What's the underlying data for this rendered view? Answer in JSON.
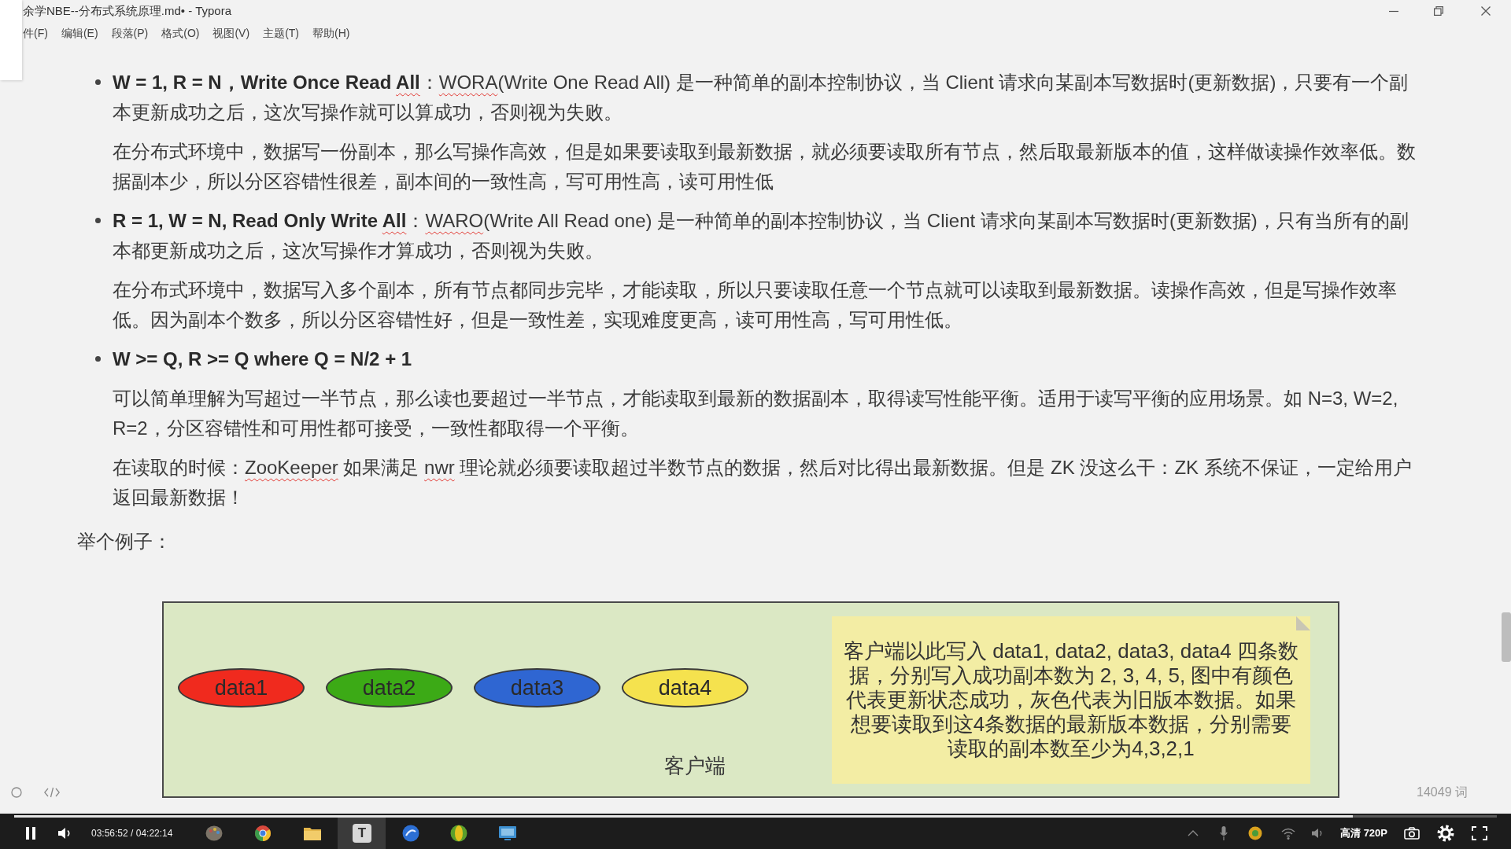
{
  "window": {
    "title": "余学NBE--分布式系统原理.md• - Typora"
  },
  "menu": [
    "件(F)",
    "编辑(E)",
    "段落(P)",
    "格式(O)",
    "视图(V)",
    "主题(T)",
    "帮助(H)"
  ],
  "document": {
    "blocks": [
      {
        "kind": "bullet",
        "runs": [
          {
            "text": "W = 1, R = N，Write Once Read ",
            "bold": true,
            "misspelled": false
          },
          {
            "text": "All",
            "bold": true,
            "misspelled": true
          },
          {
            "text": "：",
            "bold": false,
            "misspelled": false
          },
          {
            "text": "WORA",
            "bold": false,
            "misspelled": true
          },
          {
            "text": "(Write One Read All) 是一种简单的副本控制协议，当 Client 请求向某副本写数据时(更新数据)，只要有一个副本更新成功之后，这次写操作就可以算成功，否则视为失败。",
            "bold": false,
            "misspelled": false
          }
        ]
      },
      {
        "kind": "indented",
        "runs": [
          {
            "text": "在分布式环境中，数据写一份副本，那么写操作高效，但是如果要读取到最新数据，就必须要读取所有节点，然后取最新版本的值，这样做读操作效率低。数据副本少，所以分区容错性很差，副本间的一致性高，写可用性高，读可用性低",
            "bold": false,
            "misspelled": false
          }
        ]
      },
      {
        "kind": "bullet",
        "runs": [
          {
            "text": "R = 1, W = N, Read Only Write ",
            "bold": true,
            "misspelled": false
          },
          {
            "text": "All",
            "bold": true,
            "misspelled": true
          },
          {
            "text": "：",
            "bold": false,
            "misspelled": false
          },
          {
            "text": "WARO",
            "bold": false,
            "misspelled": true
          },
          {
            "text": "(Write All Read one) 是一种简单的副本控制协议，当 Client 请求向某副本写数据时(更新数据)，只有当所有的副本都更新成功之后，这次写操作才算成功，否则视为失败。",
            "bold": false,
            "misspelled": false
          }
        ]
      },
      {
        "kind": "indented",
        "runs": [
          {
            "text": "在分布式环境中，数据写入多个副本，所有节点都同步完毕，才能读取，所以只要读取任意一个节点就可以读取到最新数据。读操作高效，但是写操作效率低。因为副本个数多，所以分区容错性好，但是一致性差，实现难度更高，读可用性高，写可用性低。",
            "bold": false,
            "misspelled": false
          }
        ]
      },
      {
        "kind": "bullet",
        "runs": [
          {
            "text": "W >= Q, R >= Q where Q = N/2 + 1",
            "bold": true,
            "misspelled": false
          }
        ]
      },
      {
        "kind": "indented",
        "runs": [
          {
            "text": "可以简单理解为写超过一半节点，那么读也要超过一半节点，才能读取到最新的数据副本，取得读写性能平衡。适用于读写平衡的应用场景。如 N=3, W=2, R=2，分区容错性和可用性都可接受，一致性都取得一个平衡。",
            "bold": false,
            "misspelled": false
          }
        ]
      },
      {
        "kind": "indented",
        "runs": [
          {
            "text": "在读取的时候：",
            "bold": false,
            "misspelled": false
          },
          {
            "text": "ZooKeeper",
            "bold": false,
            "misspelled": true
          },
          {
            "text": " 如果满足 ",
            "bold": false,
            "misspelled": false
          },
          {
            "text": "nwr",
            "bold": false,
            "misspelled": true
          },
          {
            "text": " 理论就必须要读取超过半数节点的数据，然后对比得出最新数据。但是 ZK 没这么干：ZK 系统不保证，一定给用户返回最新数据！",
            "bold": false,
            "misspelled": false
          }
        ]
      },
      {
        "kind": "paragraph",
        "runs": [
          {
            "text": "举个例子：",
            "bold": false,
            "misspelled": false
          }
        ]
      }
    ],
    "diagram": {
      "nodes": [
        {
          "label": "data1",
          "color": "#f02a1e"
        },
        {
          "label": "data2",
          "color": "#3caa16"
        },
        {
          "label": "data3",
          "color": "#2f66d2"
        },
        {
          "label": "data4",
          "color": "#f5e24e"
        }
      ],
      "caption": "客户端",
      "note": "客户端以此写入 data1, data2, data3, data4 四条数据，分别写入成功副本数为 2, 3, 4, 5, 图中有颜色代表更新状态成功，灰色代表为旧版本数据。如果想要读取到这4条数据的最新版本数据，分别需要读取的副本数至少为4,3,2,1"
    }
  },
  "status_bar": {
    "word_count": "14049 词"
  },
  "video_player": {
    "playing": true,
    "time": "03:56:52 / 04:22:14",
    "progress": {
      "level": 0.903
    },
    "quality": "高清 720P"
  },
  "recorded_taskbar": {
    "active_app_letter": "T"
  }
}
